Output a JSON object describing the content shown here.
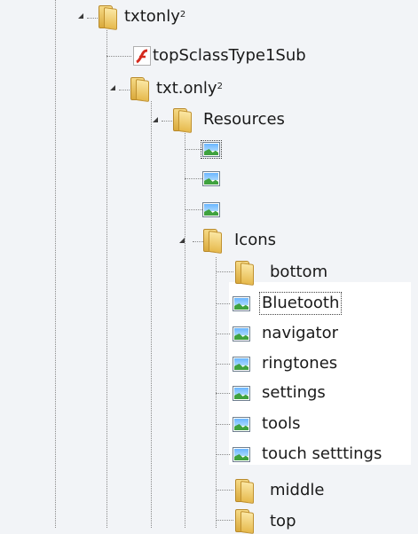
{
  "tree": {
    "root": {
      "label": "txtonly",
      "sup": "2"
    },
    "flash_file": {
      "label": "topSclassType1Sub"
    },
    "txt_only": {
      "label": "txt.only",
      "sup": "2"
    },
    "resources": {
      "label": "Resources"
    },
    "icons_folder": {
      "label": "Icons"
    },
    "bottom": {
      "label": "bottom"
    },
    "items": [
      {
        "label": "Bluetooth"
      },
      {
        "label": "navigator"
      },
      {
        "label": "ringtones"
      },
      {
        "label": "settings"
      },
      {
        "label": "tools"
      },
      {
        "label": "touch setttings"
      }
    ],
    "middle": {
      "label": "middle"
    },
    "top": {
      "label": "top"
    }
  }
}
